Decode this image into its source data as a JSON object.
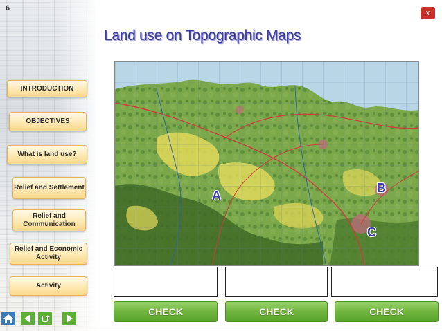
{
  "page_number": "6",
  "close_label": "x",
  "title": "Land use on Topographic Maps",
  "menu": [
    {
      "label": "INTRODUCTION"
    },
    {
      "label": "OBJECTIVES"
    },
    {
      "label": "What is land use?"
    },
    {
      "label": "Relief and Settlement"
    },
    {
      "label": "Relief and Communication"
    },
    {
      "label": "Relief and Economic Activity"
    },
    {
      "label": "Activity"
    }
  ],
  "map_markers": {
    "a": "A",
    "b": "B",
    "c": "C"
  },
  "answers": [
    "",
    "",
    ""
  ],
  "check_label": "CHECK",
  "nav_icons": [
    "home-icon",
    "back-arrow-icon",
    "return-icon",
    "forward-arrow-icon"
  ],
  "colors": {
    "title": "#3b3b9a",
    "check": "#6fb43d",
    "menu_button": "#fde9b3",
    "close": "#c9302c"
  }
}
